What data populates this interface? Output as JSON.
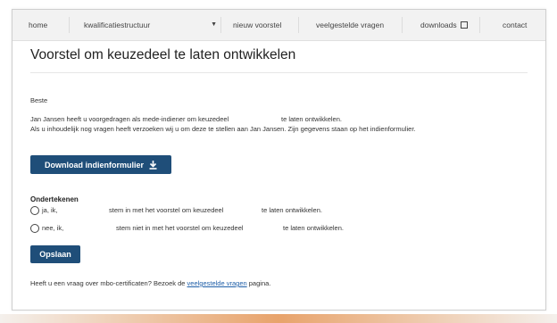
{
  "nav": {
    "items": [
      {
        "label": "home"
      },
      {
        "label": "kwalificatiestructuur"
      },
      {
        "label": "nieuw voorstel"
      },
      {
        "label": "veelgestelde vragen"
      },
      {
        "label": "downloads"
      },
      {
        "label": "contact"
      }
    ]
  },
  "page": {
    "title": "Voorstel om keuzedeel te laten ontwikkelen",
    "greeting": "Beste",
    "line1_a": "Jan Jansen heeft u voorgedragen als mede-indiener om keuzedeel",
    "line1_b": "te laten ontwikkelen.",
    "line2": "Als u inhoudelijk nog vragen heeft verzoeken wij u om deze te stellen aan Jan Jansen. Zijn gegevens staan op het indienformulier."
  },
  "download_button": {
    "label": "Download indienformulier"
  },
  "sign": {
    "heading": "Ondertekenen",
    "options": [
      {
        "prefix": "ja, ik,",
        "middle": "stem in met het voorstel om keuzedeel",
        "suffix": "te laten ontwikkelen."
      },
      {
        "prefix": "nee, ik,",
        "middle": "stem niet in met het voorstel om keuzedeel",
        "suffix": "te laten ontwikkelen."
      }
    ]
  },
  "save_button": {
    "label": "Opslaan"
  },
  "footer": {
    "text_before": "Heeft u een vraag over mbo-certificaten? Bezoek de",
    "link": "veelgestelde vragen",
    "text_after": "pagina."
  }
}
